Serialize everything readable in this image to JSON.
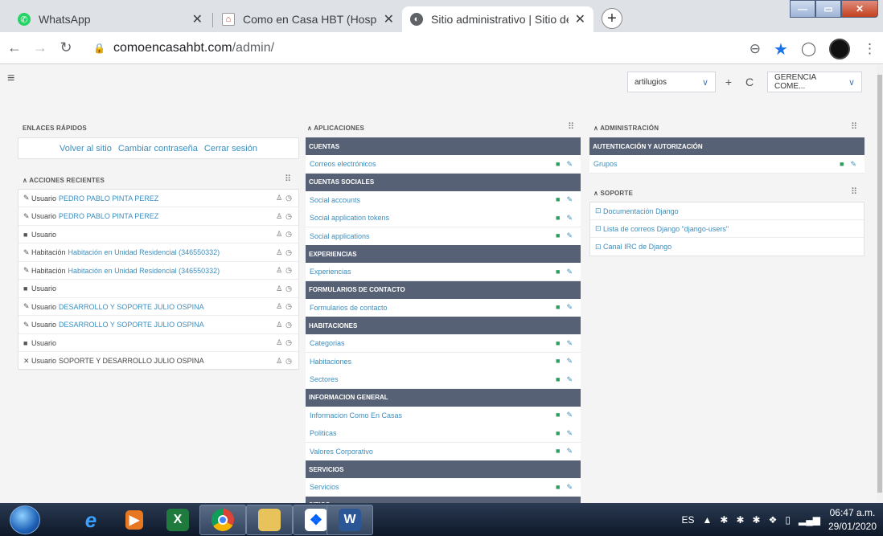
{
  "browser": {
    "tabs": [
      {
        "label": "WhatsApp",
        "icon": "whatsapp-icon"
      },
      {
        "label": "Como en Casa HBT (Hospitalidad",
        "icon": "home-icon"
      },
      {
        "label": "Sitio administrativo | Sitio de adm",
        "icon": "globe-icon"
      }
    ],
    "new_tab": "+",
    "url_host": "comoencasahbt.com",
    "url_path": "/admin/"
  },
  "topbar": {
    "select_value": "artilugios",
    "add": "+",
    "refresh": "C",
    "user_menu": "GERENCIA COME..."
  },
  "quick_links": {
    "heading": "ENLACES RÁPIDOS",
    "links": [
      "Volver al sitio",
      "Cambiar contraseña",
      "Cerrar sesión"
    ]
  },
  "recent": {
    "heading": "ACCIONES RECIENTES",
    "rows": [
      {
        "icon": "edit-icon",
        "type": "Usuario",
        "target": "PEDRO PABLO PINTA PEREZ",
        "linked": true
      },
      {
        "icon": "edit-icon",
        "type": "Usuario",
        "target": "PEDRO PABLO PINTA PEREZ",
        "linked": true
      },
      {
        "icon": "add-icon",
        "type": "Usuario",
        "target": "",
        "linked": false
      },
      {
        "icon": "edit-icon",
        "type": "Habitación",
        "target": "Habitación en Unidad Residencial (346550332)",
        "linked": true
      },
      {
        "icon": "edit-icon",
        "type": "Habitación",
        "target": "Habitación en Unidad Residencial (346550332)",
        "linked": true
      },
      {
        "icon": "add-icon",
        "type": "Usuario",
        "target": "",
        "linked": false
      },
      {
        "icon": "edit-icon",
        "type": "Usuario",
        "target": "DESARROLLO Y SOPORTE JULIO OSPINA",
        "linked": true
      },
      {
        "icon": "edit-icon",
        "type": "Usuario",
        "target": "DESARROLLO Y SOPORTE JULIO OSPINA",
        "linked": true
      },
      {
        "icon": "add-icon",
        "type": "Usuario",
        "target": "",
        "linked": false
      },
      {
        "icon": "delete-icon",
        "type": "Usuario",
        "target": "SOPORTE Y DESARROLLO JULIO OSPINA",
        "linked": false
      }
    ]
  },
  "apps": {
    "heading": "APLICACIONES",
    "groups": [
      {
        "name": "CUENTAS",
        "models": [
          "Correos electrónicos"
        ]
      },
      {
        "name": "CUENTAS SOCIALES",
        "models": [
          "Social accounts",
          "Social application tokens",
          "Social applications"
        ]
      },
      {
        "name": "EXPERIENCIAS",
        "models": [
          "Experiencias"
        ]
      },
      {
        "name": "FORMULARIOS DE CONTACTO",
        "models": [
          "Formularios de contacto"
        ]
      },
      {
        "name": "HABITACIONES",
        "models": [
          "Categorias",
          "Habitaciones",
          "Sectores"
        ]
      },
      {
        "name": "INFORMACION GENERAL",
        "models": [
          "Informacion Como En Casas",
          "Politicas",
          "Valores Corporativo"
        ]
      },
      {
        "name": "SERVICIOS",
        "models": [
          "Servicios"
        ]
      },
      {
        "name": "SITIOS",
        "models": []
      }
    ]
  },
  "admin": {
    "heading": "ADMINISTRACIÓN",
    "group": "AUTENTICACIÓN Y AUTORIZACIÓN",
    "model": "Grupos"
  },
  "support": {
    "heading": "SOPORTE",
    "links": [
      "Documentación Django",
      "Lista de correos Django \"django-users\"",
      "Canal IRC de Django"
    ]
  },
  "taskbar": {
    "lang": "ES",
    "time": "06:47 a.m.",
    "date": "29/01/2020"
  }
}
